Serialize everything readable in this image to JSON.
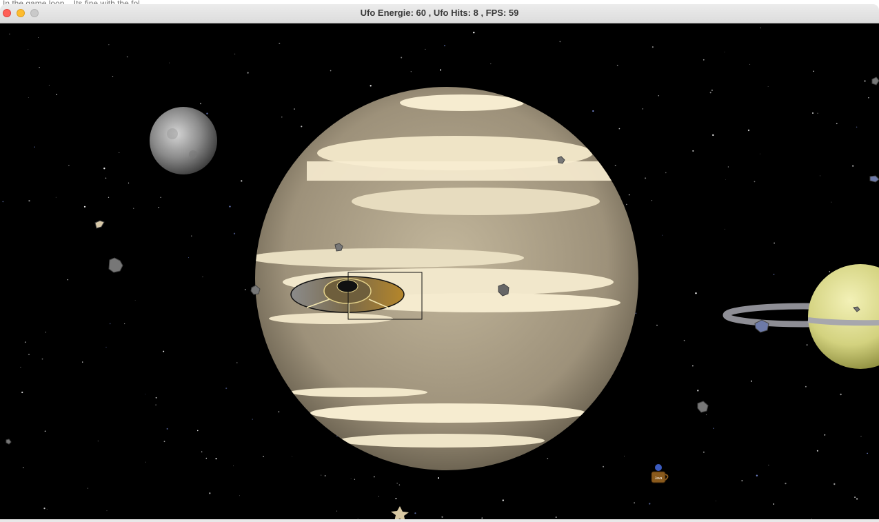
{
  "window": {
    "title": "Ufo Energie: 60 , Ufo Hits: 8 , FPS: 59",
    "background_text": "In the game loop... Its fine with the fol..."
  },
  "hud": {
    "energy": 60,
    "hits": 8,
    "fps": 59
  },
  "scene": {
    "background_color": "#000000",
    "sprites": [
      "moon",
      "gas-giant-planet",
      "ringed-planet",
      "ufo",
      "asteroid",
      "java-coffee-cup",
      "star"
    ],
    "java_cup_label": "Java"
  },
  "colors": {
    "gas_giant_base": "#b9ad93",
    "gas_giant_bands": "#f7eccd",
    "ringed_planet": "#dede8a",
    "ufo_gold": "#c9a14a"
  }
}
